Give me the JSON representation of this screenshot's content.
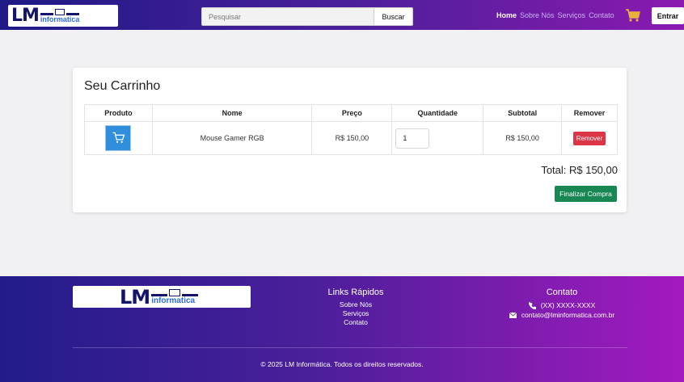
{
  "header": {
    "logo": {
      "letters": "LM",
      "subtitle": "informatica"
    },
    "search": {
      "placeholder": "Pesquisar",
      "button_label": "Buscar"
    },
    "nav": [
      {
        "label": "Home"
      },
      {
        "label": "Sobre Nós"
      },
      {
        "label": "Serviços"
      },
      {
        "label": "Contato"
      }
    ],
    "cart_icon": "shopping-cart-icon",
    "login_label": "Entrar"
  },
  "cart": {
    "title": "Seu Carrinho",
    "columns": [
      "Produto",
      "Nome",
      "Preço",
      "Quantidade",
      "Subtotal",
      "Remover"
    ],
    "items": [
      {
        "image_icon": "shopping-cart-icon",
        "name": "Mouse Gamer RGB",
        "price": "R$ 150,00",
        "quantity": "1",
        "subtotal": "R$ 150,00",
        "remove_label": "Remover"
      }
    ],
    "total": "Total: R$ 150,00",
    "checkout_label": "Finalizar Compra"
  },
  "footer": {
    "logo": {
      "letters": "LM",
      "subtitle": "informatica"
    },
    "links_heading": "Links Rápidos",
    "links": [
      {
        "label": "Sobre Nós"
      },
      {
        "label": "Serviços"
      },
      {
        "label": "Contato"
      }
    ],
    "contact_heading": "Contato",
    "phone": "(XX) XXXX-XXXX",
    "email": "contato@lminformatica.com.br",
    "copyright": "© 2025 LM Informática. Todos os direitos reservados."
  },
  "colors": {
    "header_gradient": [
      "#1e1a86",
      "#8a1ab0"
    ],
    "remove_button": "#dc3545",
    "checkout_button": "#198754",
    "logo_navy": "#14146b"
  }
}
